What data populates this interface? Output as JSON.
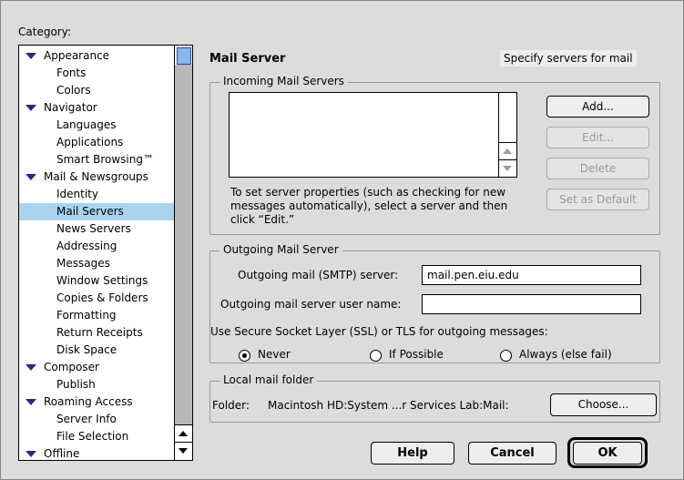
{
  "sidebar": {
    "label": "Category:",
    "items": [
      {
        "label": "Appearance",
        "level": 0,
        "expanded": true
      },
      {
        "label": "Fonts",
        "level": 1
      },
      {
        "label": "Colors",
        "level": 1
      },
      {
        "label": "Navigator",
        "level": 0,
        "expanded": true
      },
      {
        "label": "Languages",
        "level": 1
      },
      {
        "label": "Applications",
        "level": 1
      },
      {
        "label": "Smart Browsing™",
        "level": 1
      },
      {
        "label": "Mail & Newsgroups",
        "level": 0,
        "expanded": true
      },
      {
        "label": "Identity",
        "level": 1
      },
      {
        "label": "Mail Servers",
        "level": 1,
        "selected": true
      },
      {
        "label": "News Servers",
        "level": 1
      },
      {
        "label": "Addressing",
        "level": 1
      },
      {
        "label": "Messages",
        "level": 1
      },
      {
        "label": "Window Settings",
        "level": 1
      },
      {
        "label": "Copies & Folders",
        "level": 1
      },
      {
        "label": "Formatting",
        "level": 1
      },
      {
        "label": "Return Receipts",
        "level": 1
      },
      {
        "label": "Disk Space",
        "level": 1
      },
      {
        "label": "Composer",
        "level": 0,
        "expanded": true
      },
      {
        "label": "Publish",
        "level": 1
      },
      {
        "label": "Roaming Access",
        "level": 0,
        "expanded": true
      },
      {
        "label": "Server Info",
        "level": 1
      },
      {
        "label": "File Selection",
        "level": 1
      },
      {
        "label": "Offline",
        "level": 0,
        "expanded": true
      }
    ]
  },
  "panel": {
    "title": "Mail Server",
    "description": "Specify servers for mail"
  },
  "incoming": {
    "group_title": "Incoming Mail Servers",
    "add_label": "Add...",
    "edit_label": "Edit...",
    "delete_label": "Delete",
    "default_label": "Set as Default",
    "info_text": "To set server properties (such as checking for new messages automatically), select a server and then click “Edit.”"
  },
  "outgoing": {
    "group_title": "Outgoing Mail Server",
    "smtp_label": "Outgoing mail (SMTP) server:",
    "smtp_value": "mail.pen.eiu.edu",
    "username_label": "Outgoing mail server user name:",
    "username_value": "",
    "ssl_label": "Use Secure Socket Layer (SSL) or TLS for outgoing messages:",
    "ssl_options": [
      "Never",
      "If Possible",
      "Always (else fail)"
    ],
    "ssl_selected": "Never"
  },
  "local_folder": {
    "group_title": "Local mail folder",
    "folder_label": "Folder:",
    "folder_path": "Macintosh HD:System ...r Services Lab:Mail:",
    "choose_label": "Choose..."
  },
  "footer": {
    "help_label": "Help",
    "cancel_label": "Cancel",
    "ok_label": "OK"
  },
  "colors": {
    "selection": "#a8d4f0",
    "disclosure": "#1c2e80",
    "scroll_thumb": "#8ab6ec"
  }
}
